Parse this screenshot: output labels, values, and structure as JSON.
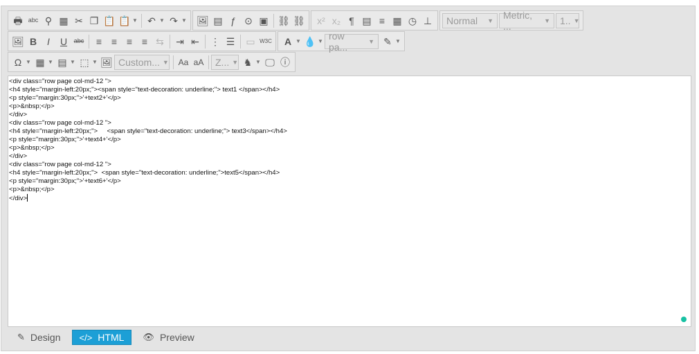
{
  "toolbar": {
    "paragraph_format": "Normal",
    "units": "Metric, ...",
    "font_size": "1..",
    "paragraph_style": "row pa...",
    "custom_insert": "Custom...",
    "zoom": "Z..."
  },
  "content": {
    "lines": [
      "<div class=\"row page col-md-12 \">",
      "<h4 style=\"margin-left:20px;\"><span style=\"text-decoration: underline;\"> text1 </span></h4>",
      "<p style=\"margin:30px;\">'+text2+'</p>",
      "<p>&nbsp;</p>",
      "</div>",
      "<div class=\"row page col-md-12 \">",
      "<h4 style=\"margin-left:20px;\">     <span style=\"text-decoration: underline;\"> text3</span></h4>",
      "<p style=\"margin:30px;\">'+text4+'</p>",
      "<p>&nbsp;</p>",
      "</div>",
      "<div class=\"row page col-md-12 \">",
      "<h4 style=\"margin-left:20px;\">  <span style=\"text-decoration: underline;\">text5</span></h4>",
      "<p style=\"margin:30px;\">'+text6+'</p>",
      "<p>&nbsp;</p>",
      "</div>"
    ]
  },
  "modes": {
    "design": "Design",
    "html": "HTML",
    "preview": "Preview"
  },
  "colors": {
    "accent": "#1c9fd6",
    "status_dot": "#17c1a3"
  }
}
